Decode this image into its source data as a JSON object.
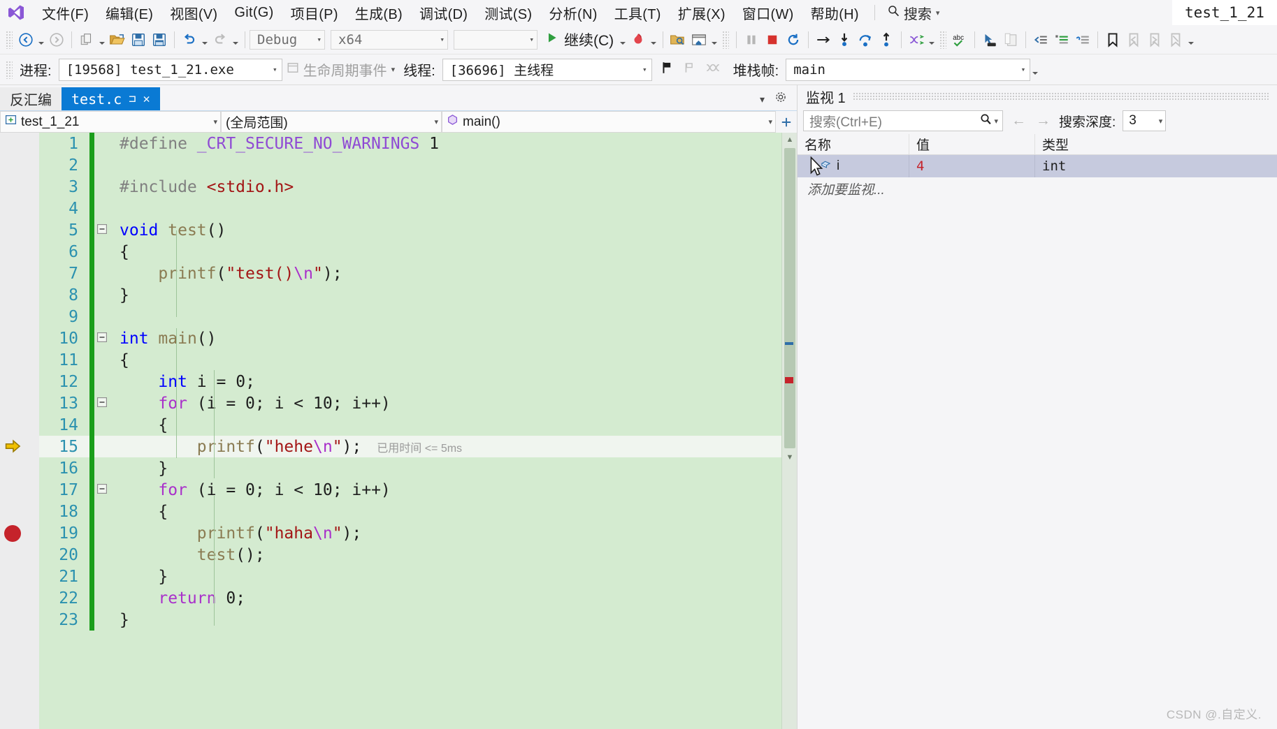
{
  "app": {
    "logo_icon": "visual-studio-logo",
    "project_tab": "test_1_21"
  },
  "menubar": {
    "items": [
      {
        "label": "文件(F)",
        "name": "file"
      },
      {
        "label": "编辑(E)",
        "name": "edit"
      },
      {
        "label": "视图(V)",
        "name": "view"
      },
      {
        "label": "Git(G)",
        "name": "git"
      },
      {
        "label": "项目(P)",
        "name": "project"
      },
      {
        "label": "生成(B)",
        "name": "build"
      },
      {
        "label": "调试(D)",
        "name": "debug"
      },
      {
        "label": "测试(S)",
        "name": "test"
      },
      {
        "label": "分析(N)",
        "name": "analyze"
      },
      {
        "label": "工具(T)",
        "name": "tools"
      },
      {
        "label": "扩展(X)",
        "name": "extensions"
      },
      {
        "label": "窗口(W)",
        "name": "window"
      },
      {
        "label": "帮助(H)",
        "name": "help"
      }
    ],
    "search_label": "搜索",
    "search_icon": "magnifier-icon"
  },
  "toolbar": {
    "back_icon": "navigate-back-icon",
    "forward_icon": "navigate-forward-icon",
    "new_item_icon": "new-item-icon",
    "open_icon": "open-folder-icon",
    "save_icon": "save-icon",
    "save_all_icon": "save-all-icon",
    "undo_icon": "undo-icon",
    "redo_icon": "redo-icon",
    "config_value": "Debug",
    "platform_value": "x64",
    "target_value": "",
    "continue_label": "继续(C)",
    "continue_icon": "play-icon",
    "hotreload_icon": "hot-reload-icon",
    "attach_icon": "attach-to-process-icon",
    "window_icon": "window-layout-icon",
    "pause_icon": "pause-icon",
    "stop_icon": "stop-icon",
    "restart_icon": "restart-icon",
    "show_next_icon": "show-next-statement-icon",
    "step_into_icon": "step-into-icon",
    "step_over_icon": "step-over-icon",
    "step_out_icon": "step-out-icon",
    "threads_icon": "threads-icon",
    "spell_icon": "spell-check-abc-icon",
    "pointer_icon": "select-pointer-icon",
    "paste_icon": "clipboard-icon",
    "outdent_icon": "outdent-icon",
    "comment_icon": "comment-lines-icon",
    "uncomment_icon": "uncomment-lines-icon",
    "bookmark_icon": "bookmark-icon",
    "prev_bookmark_icon": "previous-bookmark-icon",
    "next_bookmark_icon": "next-bookmark-icon",
    "clear_bookmark_icon": "clear-bookmarks-icon"
  },
  "debugbar": {
    "process_label": "进程:",
    "process_value": "[19568] test_1_21.exe",
    "lifecycle_label": "生命周期事件",
    "lifecycle_icon": "lifecycle-events-icon",
    "thread_label": "线程:",
    "thread_value": "[36696] 主线程",
    "flag_icon": "flag-icon",
    "flag_alt_icon": "flag-outline-icon",
    "link_icon": "thread-link-icon",
    "stackframe_label": "堆栈帧:",
    "stackframe_value": "main"
  },
  "editor": {
    "tabs": [
      {
        "label": "反汇编",
        "active": false,
        "name": "disassembly"
      },
      {
        "label": "test.c",
        "active": true,
        "name": "test-c",
        "pin_icon": "pin-icon",
        "close_icon": "close-icon"
      }
    ],
    "nav": {
      "project_value": "test_1_21",
      "project_icon": "project-icon",
      "scope_value": "(全局范围)",
      "member_value": "main()",
      "member_icon": "method-icon",
      "expand_icon": "expand-toolbar-icon"
    },
    "current_line": 15,
    "breakpoint_line": 19,
    "elapsed_annotation": "已用时间 <= 5ms",
    "lines": [
      {
        "n": 1,
        "fold": "",
        "tokens": [
          {
            "t": "#define ",
            "c": "kw-gray"
          },
          {
            "t": "_CRT_SECURE_NO_WARNINGS ",
            "c": "macro"
          },
          {
            "t": "1",
            "c": "plain"
          }
        ],
        "indent": 1
      },
      {
        "n": 2,
        "fold": "",
        "tokens": [],
        "indent": 1
      },
      {
        "n": 3,
        "fold": "",
        "tokens": [
          {
            "t": "#include ",
            "c": "kw-gray"
          },
          {
            "t": "<stdio.h>",
            "c": "inc-file"
          }
        ],
        "indent": 1
      },
      {
        "n": 4,
        "fold": "",
        "tokens": [],
        "indent": 0
      },
      {
        "n": 5,
        "fold": "-",
        "tokens": [
          {
            "t": "void",
            "c": "kw-blue"
          },
          {
            "t": " ",
            "c": "plain"
          },
          {
            "t": "test",
            "c": "fn"
          },
          {
            "t": "()",
            "c": "plain"
          }
        ],
        "indent": 0
      },
      {
        "n": 6,
        "fold": "",
        "tokens": [
          {
            "t": "{",
            "c": "plain"
          }
        ],
        "indent": 0
      },
      {
        "n": 7,
        "fold": "",
        "tokens": [
          {
            "t": "    ",
            "c": "plain"
          },
          {
            "t": "printf",
            "c": "fn"
          },
          {
            "t": "(",
            "c": "plain"
          },
          {
            "t": "\"test()",
            "c": "str"
          },
          {
            "t": "\\n",
            "c": "esc"
          },
          {
            "t": "\"",
            "c": "str"
          },
          {
            "t": ");",
            "c": "plain"
          }
        ],
        "indent": 0
      },
      {
        "n": 8,
        "fold": "",
        "tokens": [
          {
            "t": "}",
            "c": "plain"
          }
        ],
        "indent": 0
      },
      {
        "n": 9,
        "fold": "",
        "tokens": [],
        "indent": 0
      },
      {
        "n": 10,
        "fold": "-",
        "tokens": [
          {
            "t": "int",
            "c": "kw-blue"
          },
          {
            "t": " ",
            "c": "plain"
          },
          {
            "t": "main",
            "c": "fn"
          },
          {
            "t": "()",
            "c": "plain"
          }
        ],
        "indent": 0
      },
      {
        "n": 11,
        "fold": "",
        "tokens": [
          {
            "t": "{",
            "c": "plain"
          }
        ],
        "indent": 0
      },
      {
        "n": 12,
        "fold": "",
        "tokens": [
          {
            "t": "    ",
            "c": "plain"
          },
          {
            "t": "int",
            "c": "kw-blue"
          },
          {
            "t": " i ",
            "c": "plain"
          },
          {
            "t": "=",
            "c": "plain"
          },
          {
            "t": " ",
            "c": "plain"
          },
          {
            "t": "0",
            "c": "num"
          },
          {
            "t": ";",
            "c": "plain"
          }
        ],
        "indent": 0
      },
      {
        "n": 13,
        "fold": "-",
        "tokens": [
          {
            "t": "    ",
            "c": "plain"
          },
          {
            "t": "for",
            "c": "kw-purple"
          },
          {
            "t": " (i = ",
            "c": "plain"
          },
          {
            "t": "0",
            "c": "num"
          },
          {
            "t": "; i < ",
            "c": "plain"
          },
          {
            "t": "10",
            "c": "num"
          },
          {
            "t": "; i++)",
            "c": "plain"
          }
        ],
        "indent": 0
      },
      {
        "n": 14,
        "fold": "",
        "tokens": [
          {
            "t": "    {",
            "c": "plain"
          }
        ],
        "indent": 0
      },
      {
        "n": 15,
        "fold": "",
        "tokens": [
          {
            "t": "        ",
            "c": "plain"
          },
          {
            "t": "printf",
            "c": "fn"
          },
          {
            "t": "(",
            "c": "plain"
          },
          {
            "t": "\"hehe",
            "c": "str"
          },
          {
            "t": "\\n",
            "c": "esc"
          },
          {
            "t": "\"",
            "c": "str"
          },
          {
            "t": ");",
            "c": "plain"
          }
        ],
        "indent": 0
      },
      {
        "n": 16,
        "fold": "",
        "tokens": [
          {
            "t": "    }",
            "c": "plain"
          }
        ],
        "indent": 0
      },
      {
        "n": 17,
        "fold": "-",
        "tokens": [
          {
            "t": "    ",
            "c": "plain"
          },
          {
            "t": "for",
            "c": "kw-purple"
          },
          {
            "t": " (i = ",
            "c": "plain"
          },
          {
            "t": "0",
            "c": "num"
          },
          {
            "t": "; i < ",
            "c": "plain"
          },
          {
            "t": "10",
            "c": "num"
          },
          {
            "t": "; i++)",
            "c": "plain"
          }
        ],
        "indent": 0
      },
      {
        "n": 18,
        "fold": "",
        "tokens": [
          {
            "t": "    {",
            "c": "plain"
          }
        ],
        "indent": 0
      },
      {
        "n": 19,
        "fold": "",
        "tokens": [
          {
            "t": "        ",
            "c": "plain"
          },
          {
            "t": "printf",
            "c": "fn"
          },
          {
            "t": "(",
            "c": "plain"
          },
          {
            "t": "\"haha",
            "c": "str"
          },
          {
            "t": "\\n",
            "c": "esc"
          },
          {
            "t": "\"",
            "c": "str"
          },
          {
            "t": ");",
            "c": "plain"
          }
        ],
        "indent": 0
      },
      {
        "n": 20,
        "fold": "",
        "tokens": [
          {
            "t": "        ",
            "c": "plain"
          },
          {
            "t": "test",
            "c": "fn"
          },
          {
            "t": "();",
            "c": "plain"
          }
        ],
        "indent": 0
      },
      {
        "n": 21,
        "fold": "",
        "tokens": [
          {
            "t": "    }",
            "c": "plain"
          }
        ],
        "indent": 0
      },
      {
        "n": 22,
        "fold": "",
        "tokens": [
          {
            "t": "    ",
            "c": "plain"
          },
          {
            "t": "return",
            "c": "kw-purple"
          },
          {
            "t": " ",
            "c": "plain"
          },
          {
            "t": "0",
            "c": "num"
          },
          {
            "t": ";",
            "c": "plain"
          }
        ],
        "indent": 0
      },
      {
        "n": 23,
        "fold": "",
        "tokens": [
          {
            "t": "}",
            "c": "plain"
          }
        ],
        "indent": 0
      }
    ]
  },
  "watch": {
    "title": "监视 1",
    "search_placeholder": "搜索(Ctrl+E)",
    "search_icon": "magnifier-icon",
    "prev_icon": "arrow-left-icon",
    "next_icon": "arrow-right-icon",
    "depth_label": "搜索深度:",
    "depth_value": "3",
    "columns": [
      "名称",
      "值",
      "类型"
    ],
    "rows": [
      {
        "name": "i",
        "value": "4",
        "type": "int",
        "icon": "variable-icon"
      }
    ],
    "add_placeholder": "添加要监视..."
  },
  "watermark": "CSDN @.自定义.",
  "colors": {
    "accent": "#0a7ad4",
    "code_background": "#d4ebd0",
    "changed_bar": "#1a9e1a",
    "breakpoint": "#c5232b",
    "current_arrow": "#e3a700",
    "watch_row_selected": "#c6cade"
  }
}
